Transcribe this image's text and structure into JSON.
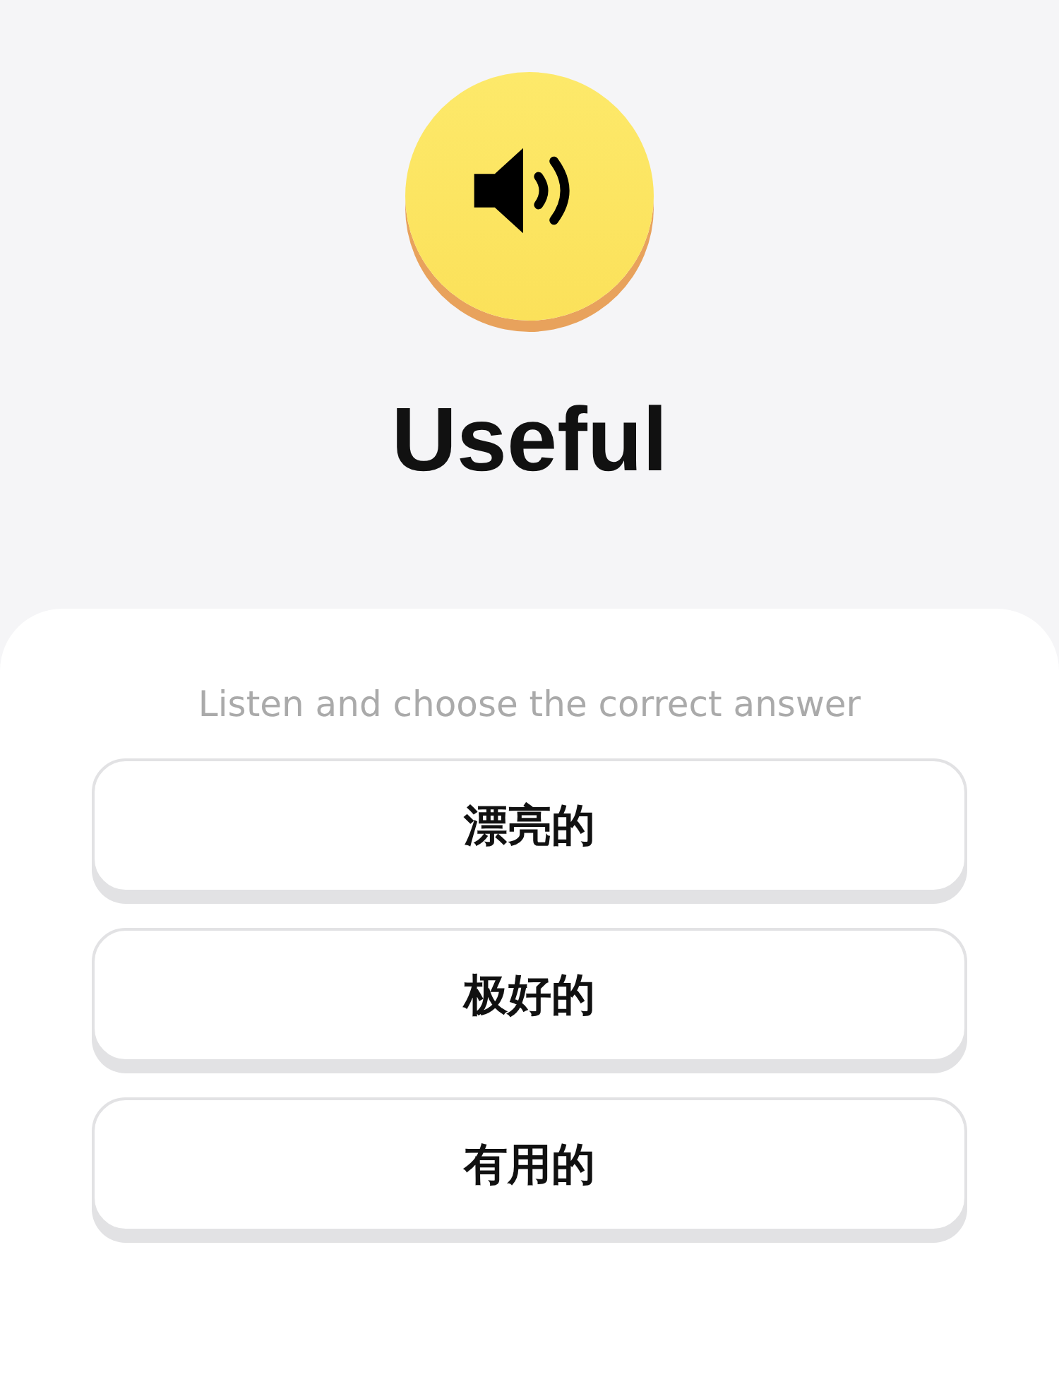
{
  "word": "Useful",
  "instruction": "Listen and choose the correct answer",
  "options": [
    {
      "label": "漂亮的"
    },
    {
      "label": "极好的"
    },
    {
      "label": "有用的"
    }
  ]
}
